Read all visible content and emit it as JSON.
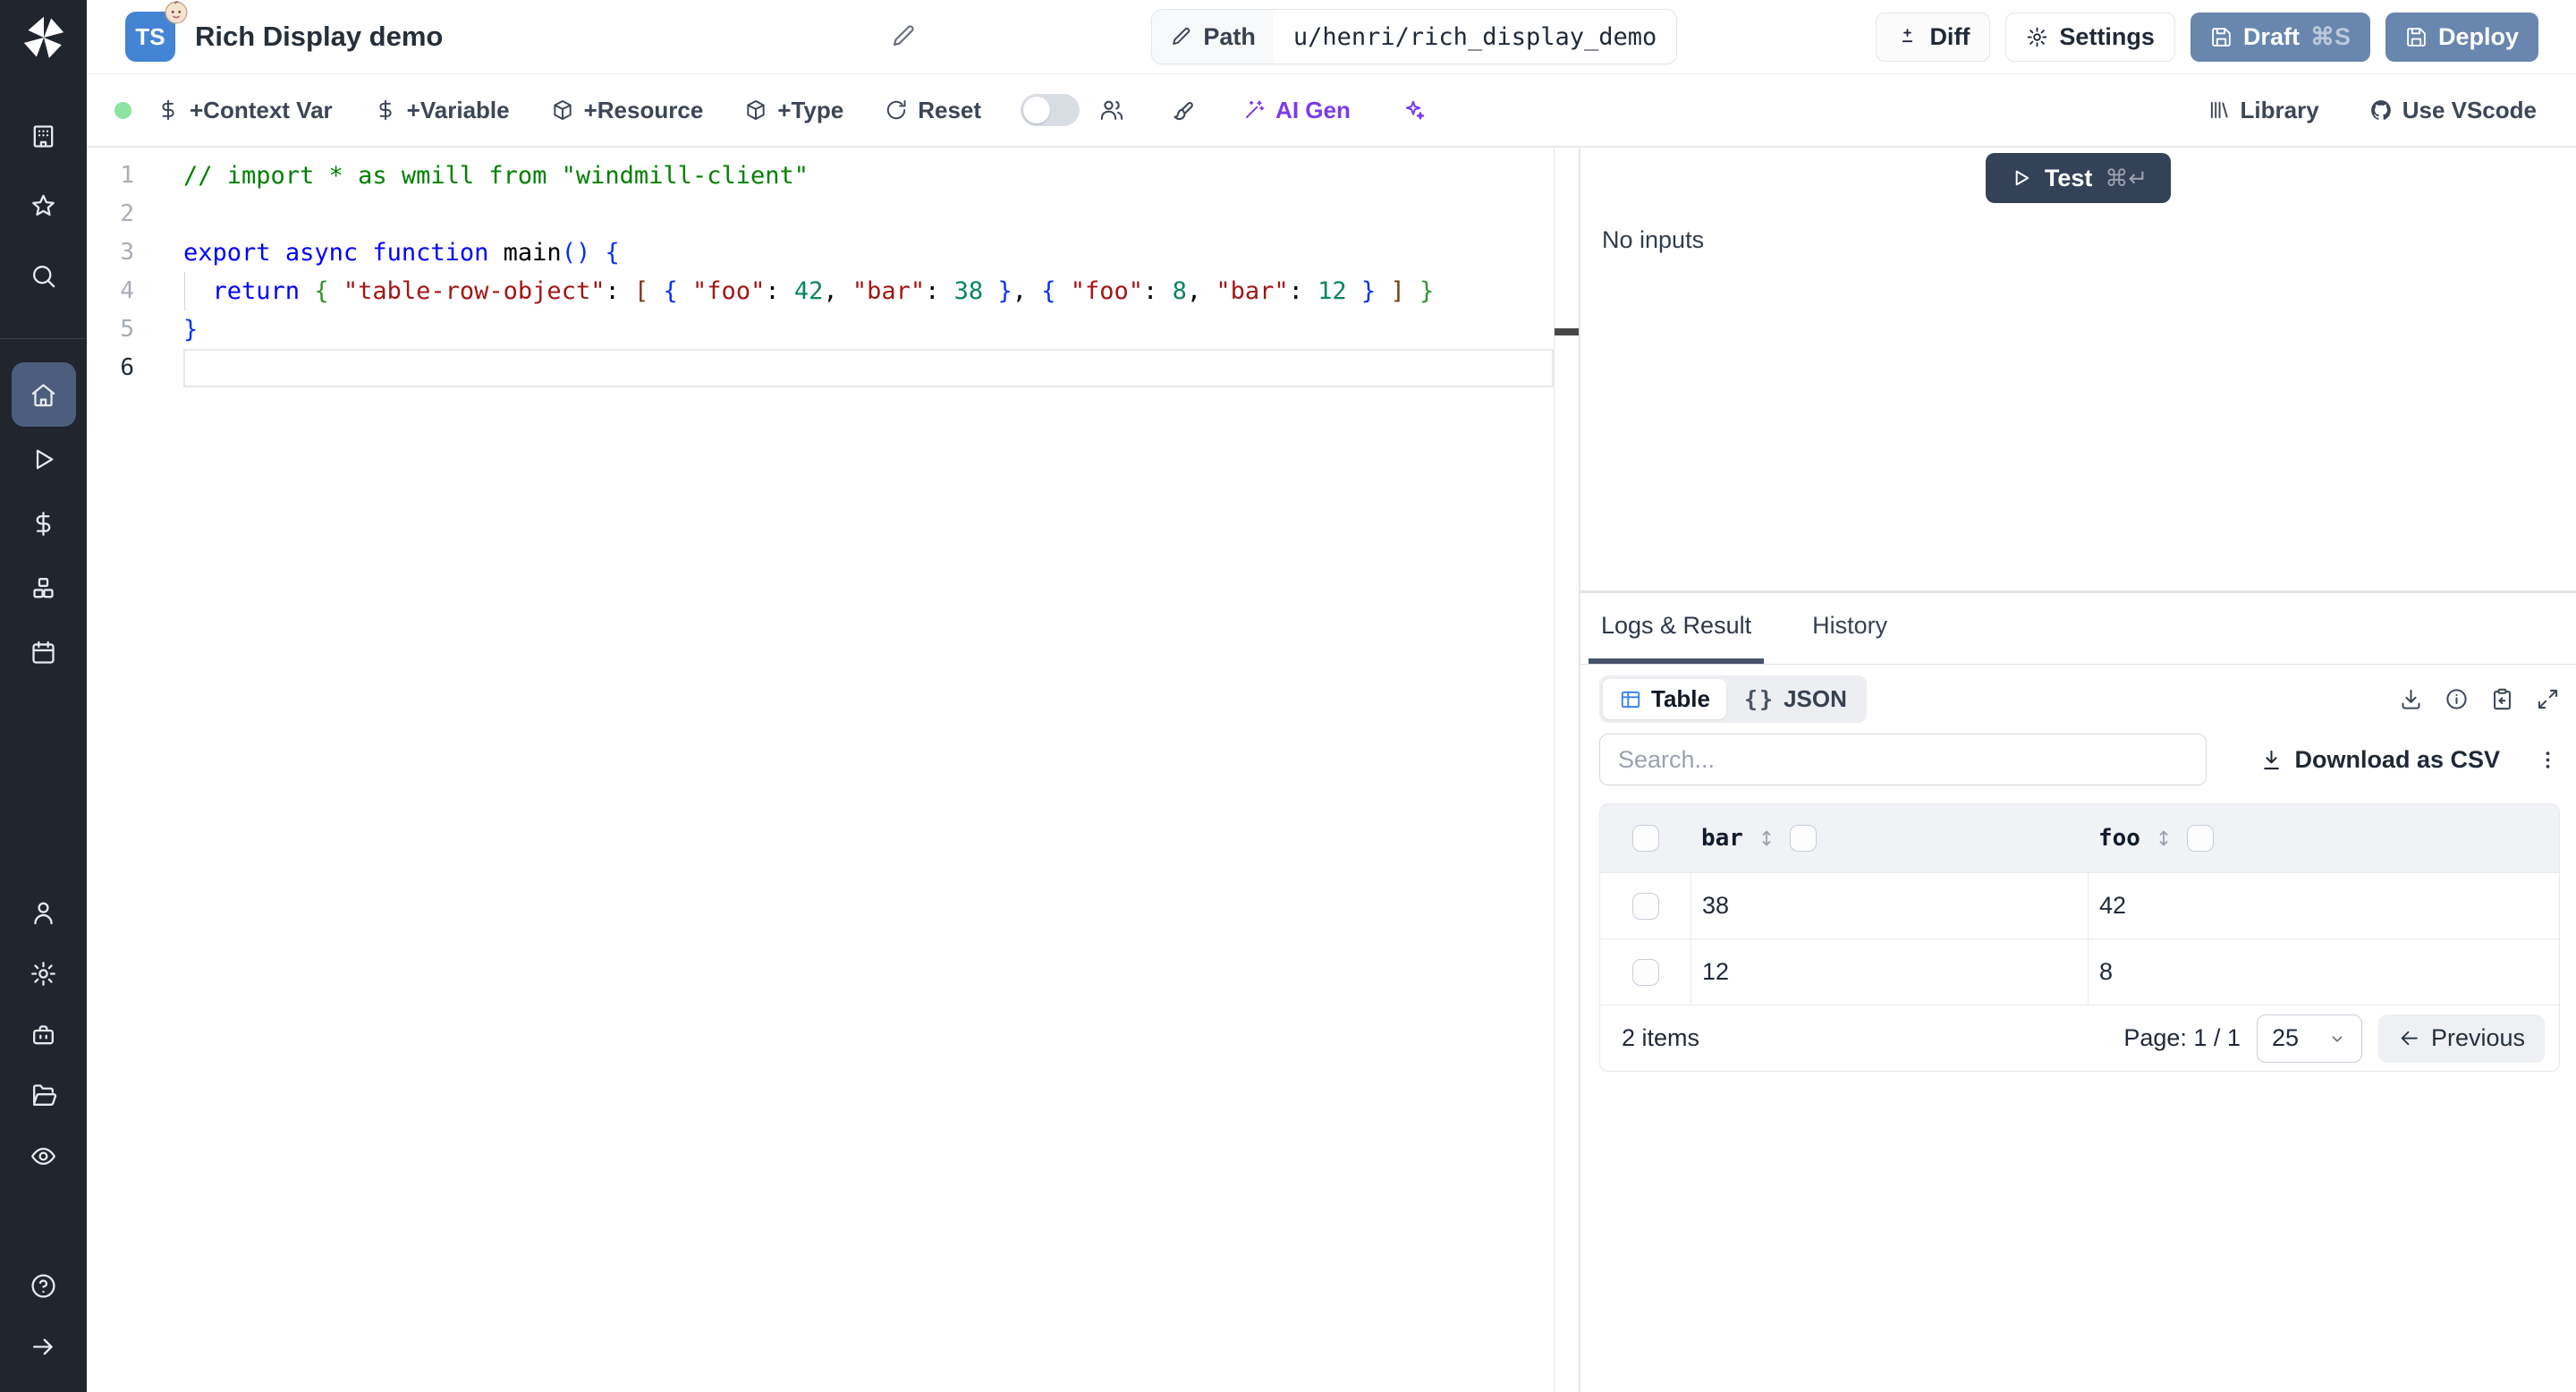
{
  "header": {
    "badge": "TS",
    "title": "Rich Display demo",
    "path_label": "Path",
    "path_value": "u/henri/rich_display_demo",
    "diff": "Diff",
    "settings": "Settings",
    "draft": "Draft",
    "draft_shortcut": "⌘S",
    "deploy": "Deploy"
  },
  "toolbar": {
    "context_var": "+Context Var",
    "variable": "+Variable",
    "resource": "+Resource",
    "type": "+Type",
    "reset": "Reset",
    "ai_gen": "AI Gen",
    "library": "Library",
    "use_vscode": "Use VScode"
  },
  "sidebar": {
    "logo": "windmill-logo",
    "top_items": [
      {
        "name": "workspace",
        "icon": "building"
      },
      {
        "name": "favorites",
        "icon": "star"
      },
      {
        "name": "search",
        "icon": "search"
      }
    ],
    "main_items": [
      {
        "name": "home",
        "icon": "home",
        "active": true
      },
      {
        "name": "runs",
        "icon": "play"
      },
      {
        "name": "variables",
        "icon": "dollar"
      },
      {
        "name": "resources",
        "icon": "boxes"
      },
      {
        "name": "schedules",
        "icon": "calendar"
      }
    ],
    "bottom_items": [
      {
        "name": "user",
        "icon": "user"
      },
      {
        "name": "settings",
        "icon": "gear"
      },
      {
        "name": "workers",
        "icon": "toolbox"
      },
      {
        "name": "folders",
        "icon": "folder-open"
      },
      {
        "name": "audit-logs",
        "icon": "eye"
      }
    ],
    "footer_items": [
      {
        "name": "help",
        "icon": "help"
      },
      {
        "name": "expand",
        "icon": "arrow-right"
      }
    ]
  },
  "editor": {
    "active_line": 6,
    "lines": [
      {
        "n": "1",
        "tokens": [
          [
            "// import * as wmill from \"windmill-client\"",
            "cm"
          ]
        ]
      },
      {
        "n": "2",
        "tokens": []
      },
      {
        "n": "3",
        "tokens": [
          [
            "export",
            "kw"
          ],
          [
            " ",
            "pl"
          ],
          [
            "async",
            "kw"
          ],
          [
            " ",
            "pl"
          ],
          [
            "function",
            "kw"
          ],
          [
            " main",
            "pl"
          ],
          [
            "()",
            "b1"
          ],
          [
            " ",
            "pl"
          ],
          [
            "{",
            "b1"
          ]
        ]
      },
      {
        "n": "4",
        "guide": true,
        "tokens": [
          [
            "  ",
            "pl"
          ],
          [
            "return",
            "kw"
          ],
          [
            " ",
            "pl"
          ],
          [
            "{",
            "b2"
          ],
          [
            " ",
            "pl"
          ],
          [
            "\"table-row-object\"",
            "st"
          ],
          [
            ": ",
            "pl"
          ],
          [
            "[",
            "b3"
          ],
          [
            " ",
            "pl"
          ],
          [
            "{",
            "b1"
          ],
          [
            " ",
            "pl"
          ],
          [
            "\"foo\"",
            "st"
          ],
          [
            ": ",
            "pl"
          ],
          [
            "42",
            "nu"
          ],
          [
            ", ",
            "pl"
          ],
          [
            "\"bar\"",
            "st"
          ],
          [
            ": ",
            "pl"
          ],
          [
            "38",
            "nu"
          ],
          [
            " ",
            "pl"
          ],
          [
            "}",
            "b1"
          ],
          [
            ", ",
            "pl"
          ],
          [
            "{",
            "b1"
          ],
          [
            " ",
            "pl"
          ],
          [
            "\"foo\"",
            "st"
          ],
          [
            ": ",
            "pl"
          ],
          [
            "8",
            "nu"
          ],
          [
            ", ",
            "pl"
          ],
          [
            "\"bar\"",
            "st"
          ],
          [
            ": ",
            "pl"
          ],
          [
            "12",
            "nu"
          ],
          [
            " ",
            "pl"
          ],
          [
            "}",
            "b1"
          ],
          [
            " ",
            "pl"
          ],
          [
            "]",
            "b3"
          ],
          [
            " ",
            "pl"
          ],
          [
            "}",
            "b2"
          ]
        ]
      },
      {
        "n": "5",
        "tokens": [
          [
            "}",
            "b1"
          ]
        ]
      },
      {
        "n": "6",
        "tokens": []
      }
    ]
  },
  "run_panel": {
    "test": "Test",
    "shortcut": "⌘↵",
    "no_inputs": "No inputs"
  },
  "results": {
    "tab_logs": "Logs & Result",
    "tab_history": "History",
    "view_table": "Table",
    "view_json": "JSON",
    "braces_glyph": "{}",
    "search_placeholder": "Search...",
    "download_csv": "Download as CSV",
    "table": {
      "columns": [
        "bar",
        "foo"
      ],
      "rows": [
        [
          "38",
          "42"
        ],
        [
          "12",
          "8"
        ]
      ],
      "footer": {
        "items": "2 items",
        "page": "Page: 1 / 1",
        "page_size": "25",
        "previous": "Previous"
      }
    }
  },
  "colors": {
    "accent_button": "#6886ae",
    "dark_button": "#344258",
    "ai_purple": "#7c3aed",
    "status_green": "#8be49f",
    "sidebar_bg": "#20252e",
    "sidebar_active": "#4c5d7d",
    "table_icon_blue": "#3b82f6",
    "code": {
      "comment": "#008000",
      "keyword": "#0000ff",
      "string": "#a31515",
      "number": "#098658",
      "bracket1": "#0431fa",
      "bracket2": "#319331",
      "bracket3": "#7b3814"
    }
  }
}
